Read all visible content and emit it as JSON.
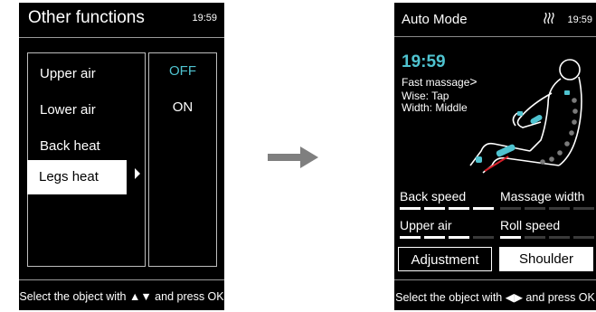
{
  "left_screen": {
    "title": "Other functions",
    "time": "19:59",
    "menu_items": [
      "Upper air",
      "Lower air",
      "Back heat",
      "Legs heat"
    ],
    "selected_index": 3,
    "options": [
      {
        "label": "OFF",
        "color": "#4fc3d0"
      },
      {
        "label": "ON",
        "color": "#ffffff"
      }
    ],
    "footer": "Select the object with ▲▼ and press OK"
  },
  "right_screen": {
    "title": "Auto Mode",
    "time": "19:59",
    "status_icon": "heat-steam-icon",
    "clock": "19:59",
    "program": "Fast massage",
    "program_arrow": ">",
    "wise": "Wise: Tap",
    "width": "Width: Middle",
    "settings": [
      {
        "label": "Back speed",
        "level": 4,
        "max": 4
      },
      {
        "label": "Massage width",
        "level": 0,
        "max": 4
      },
      {
        "label": "Upper air",
        "level": 3,
        "max": 4
      },
      {
        "label": "Roll speed",
        "level": 1,
        "max": 4
      }
    ],
    "buttons": [
      {
        "label": "Adjustment",
        "selected": false
      },
      {
        "label": "Shoulder",
        "selected": true
      }
    ],
    "footer": "Select the object with ◀▶ and press OK"
  },
  "colors": {
    "accent": "#4fc3d0",
    "background": "#000000",
    "highlight": "#ffffff",
    "red_line": "#d8202a"
  }
}
